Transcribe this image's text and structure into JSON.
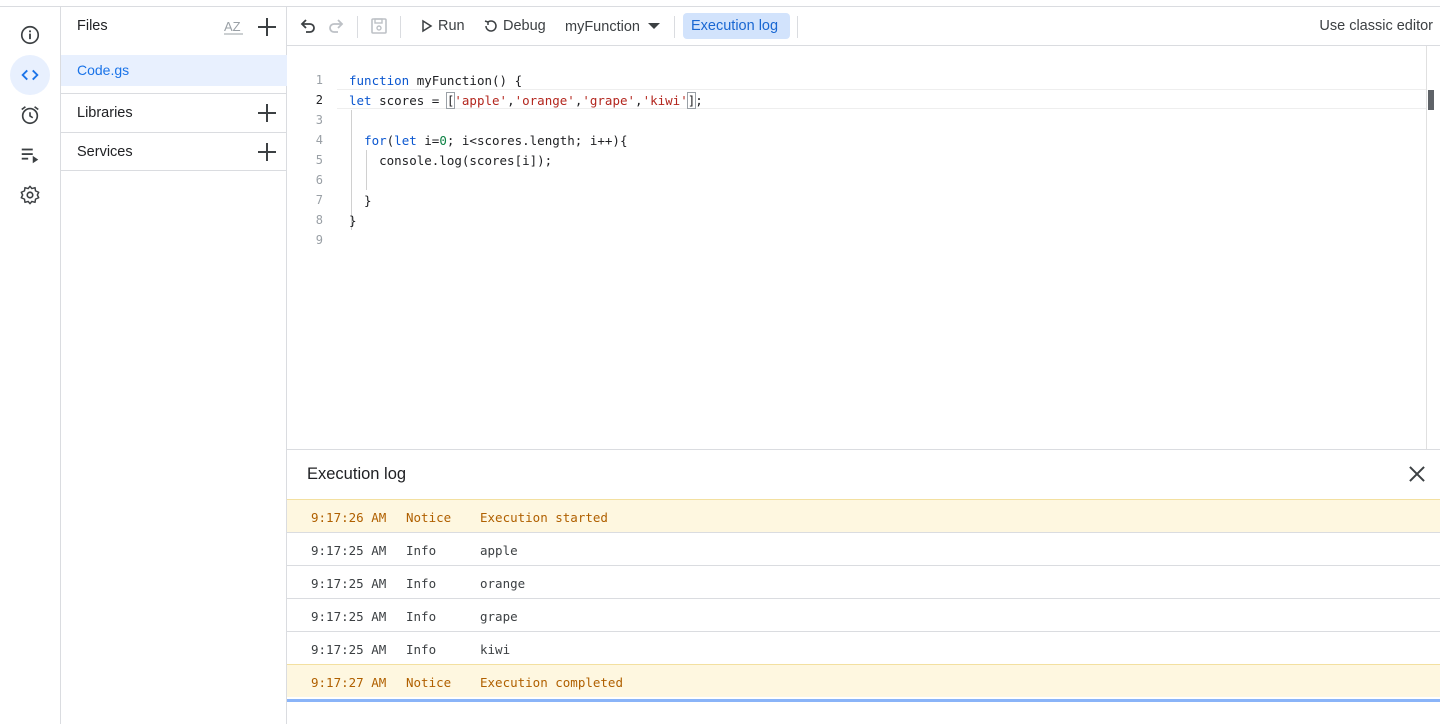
{
  "files_panel": {
    "title": "Files",
    "sort_label": "AZ",
    "file": "Code.gs",
    "libraries": "Libraries",
    "services": "Services"
  },
  "toolbar": {
    "run": "Run",
    "debug": "Debug",
    "function_select": "myFunction",
    "execution_log": "Execution log",
    "classic_editor": "Use classic editor"
  },
  "editor": {
    "current_line": 2,
    "line_numbers": [
      "1",
      "2",
      "3",
      "4",
      "5",
      "6",
      "7",
      "8",
      "9"
    ]
  },
  "log": {
    "title": "Execution log",
    "rows": [
      {
        "time": "9:17:26 AM",
        "level": "Notice",
        "message": "Execution started"
      },
      {
        "time": "9:17:25 AM",
        "level": "Info",
        "message": "apple"
      },
      {
        "time": "9:17:25 AM",
        "level": "Info",
        "message": "orange"
      },
      {
        "time": "9:17:25 AM",
        "level": "Info",
        "message": "grape"
      },
      {
        "time": "9:17:25 AM",
        "level": "Info",
        "message": "kiwi"
      },
      {
        "time": "9:17:27 AM",
        "level": "Notice",
        "message": "Execution completed"
      }
    ]
  },
  "colors": {
    "accent": "#1a73e8",
    "notice_bg": "#fef7e0",
    "notice_text": "#b06000"
  }
}
